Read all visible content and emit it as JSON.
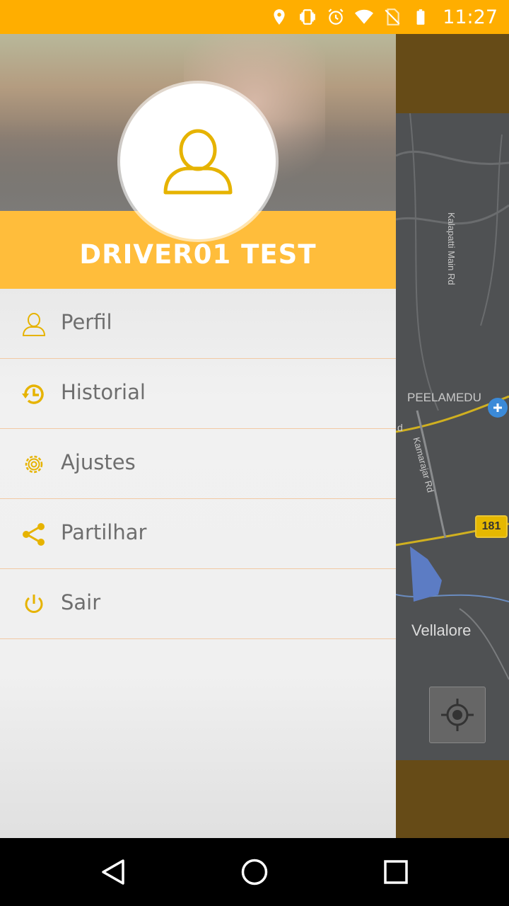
{
  "status_bar": {
    "time": "11:27",
    "icons": [
      "location-icon",
      "vibrate-icon",
      "alarm-icon",
      "wifi-icon",
      "no-sim-icon",
      "battery-icon"
    ],
    "color": "#ffae00"
  },
  "drawer": {
    "driver_name": "DRIVER01 TEST",
    "avatar_icon": "user-icon",
    "accent": "#ffbd3b",
    "icon_color": "#e6b300",
    "items": [
      {
        "label": "Perfil",
        "icon": "user-icon"
      },
      {
        "label": "Historial",
        "icon": "history-icon"
      },
      {
        "label": "Ajustes",
        "icon": "gear-icon"
      },
      {
        "label": "Partilhar",
        "icon": "share-icon"
      },
      {
        "label": "Sair",
        "icon": "power-icon"
      }
    ]
  },
  "map": {
    "labels": {
      "road1": "Kalapatti Main Rd",
      "area": "PEELAMEDU",
      "road2": "Kamarajar Rd",
      "road3": "d",
      "town": "Vellalore",
      "highway": "181"
    }
  },
  "nav_bar": {
    "buttons": [
      "back-icon",
      "home-icon",
      "recents-icon"
    ]
  }
}
